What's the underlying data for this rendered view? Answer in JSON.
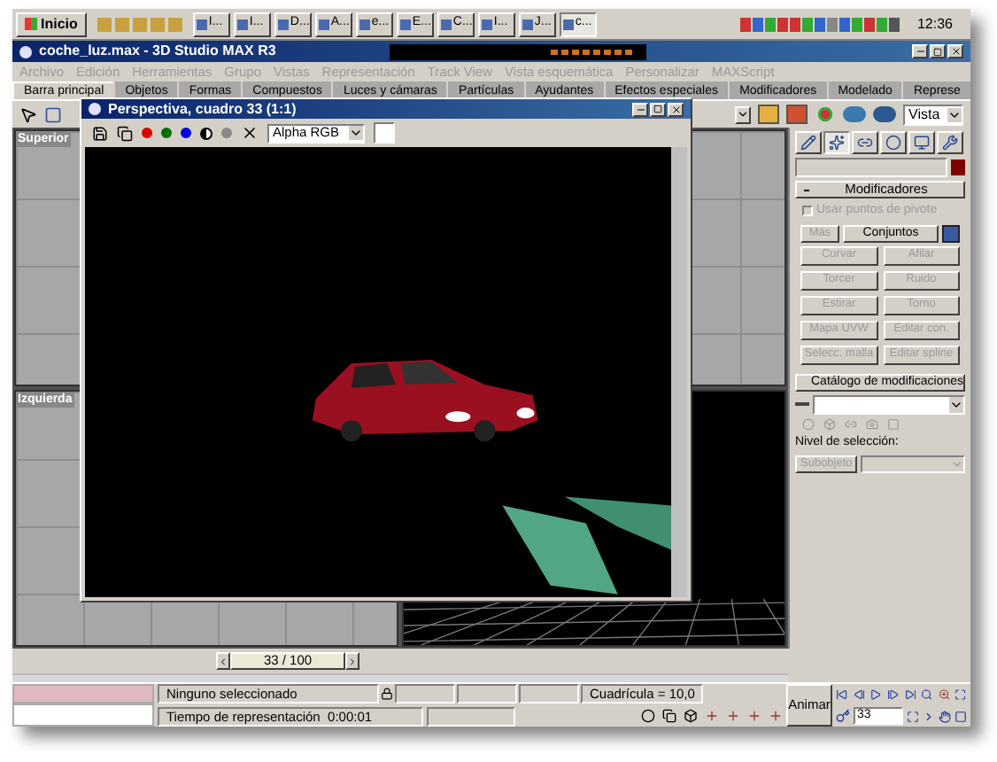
{
  "taskbar": {
    "start": "Inicio",
    "tasks": [
      {
        "label": "I...",
        "selected": false
      },
      {
        "label": "I...",
        "selected": false
      },
      {
        "label": "D...",
        "selected": false
      },
      {
        "label": "A...",
        "selected": false
      },
      {
        "label": "e...",
        "selected": false
      },
      {
        "label": "E...",
        "selected": false
      },
      {
        "label": "C...",
        "selected": false
      },
      {
        "label": "I...",
        "selected": false
      },
      {
        "label": "J...",
        "selected": false
      },
      {
        "label": "c...",
        "selected": true
      }
    ],
    "clock": "12:36"
  },
  "window": {
    "title": "coche_luz.max - 3D Studio MAX R3"
  },
  "menu": [
    {
      "label": "Archivo",
      "disabled": true
    },
    {
      "label": "Edición",
      "disabled": true
    },
    {
      "label": "Herramientas",
      "disabled": true
    },
    {
      "label": "Grupo",
      "disabled": true
    },
    {
      "label": "Vistas",
      "disabled": true
    },
    {
      "label": "Representación",
      "disabled": true
    },
    {
      "label": "Track View",
      "disabled": true
    },
    {
      "label": "Vista esquemática",
      "disabled": true
    },
    {
      "label": "Personalizar",
      "disabled": true
    },
    {
      "label": "MAXScript",
      "disabled": true
    }
  ],
  "tabs": [
    {
      "label": "Barra principal",
      "selected": true
    },
    {
      "label": "Objetos",
      "selected": false
    },
    {
      "label": "Formas",
      "selected": false
    },
    {
      "label": "Compuestos",
      "selected": false
    },
    {
      "label": "Luces y cámaras",
      "selected": false
    },
    {
      "label": "Partículas",
      "selected": false
    },
    {
      "label": "Ayudantes",
      "selected": false
    },
    {
      "label": "Efectos especiales",
      "selected": false
    },
    {
      "label": "Modificadores",
      "selected": false
    },
    {
      "label": "Modelado",
      "selected": false
    },
    {
      "label": "Represe",
      "selected": false
    }
  ],
  "toolbar": {
    "view_dropdown": "Vista"
  },
  "viewports": [
    {
      "label": "Superior"
    },
    {
      "label": "Izquierda"
    }
  ],
  "render_window": {
    "title": "Perspectiva, cuadro 33 (1:1)",
    "channels": [
      {
        "color": "#e00000",
        "selected": true
      },
      {
        "color": "#007000",
        "selected": true
      },
      {
        "color": "#0000e0",
        "selected": true
      }
    ],
    "channel_dropdown": "Alpha RGB"
  },
  "command_panel": {
    "tabs": [
      {
        "kind": "create",
        "selected": false
      },
      {
        "kind": "modify",
        "selected": true
      },
      {
        "kind": "hierarchy",
        "selected": false
      },
      {
        "kind": "motion",
        "selected": false
      },
      {
        "kind": "display",
        "selected": false
      },
      {
        "kind": "utilities",
        "selected": false
      }
    ],
    "modifiers": {
      "title": "Modificadores",
      "pivot": {
        "label": "Usar puntos de pivote",
        "checked": false,
        "disabled": true
      },
      "more": {
        "label": "Más",
        "disabled": true
      },
      "sets": {
        "label": "Conjuntos",
        "disabled": false
      },
      "buttons": [
        {
          "label": "Curvar",
          "disabled": true
        },
        {
          "label": "Afilar",
          "disabled": true
        },
        {
          "label": "Torcer",
          "disabled": true
        },
        {
          "label": "Ruido",
          "disabled": true
        },
        {
          "label": "Estirar",
          "disabled": true
        },
        {
          "label": "Torno",
          "disabled": true
        },
        {
          "label": "Mapa UVW",
          "disabled": true
        },
        {
          "label": "Editar con.",
          "disabled": true
        },
        {
          "label": "Selecc. malla",
          "disabled": true
        },
        {
          "label": "Editar spline",
          "disabled": true
        }
      ]
    },
    "catalog": {
      "title": "Catálogo de modificaciones",
      "level_label": "Nivel de selección:",
      "subobject": {
        "label": "Subobjeto",
        "disabled": true
      }
    }
  },
  "time_slider": {
    "reading": "33 / 100"
  },
  "status": {
    "selection": "Ninguno seleccionado",
    "grid": "Cuadrícula = 10,0",
    "render_time": "Tiempo de representación  0:00:01",
    "animate": {
      "label": "Animar",
      "on": false
    },
    "frame": "33"
  }
}
